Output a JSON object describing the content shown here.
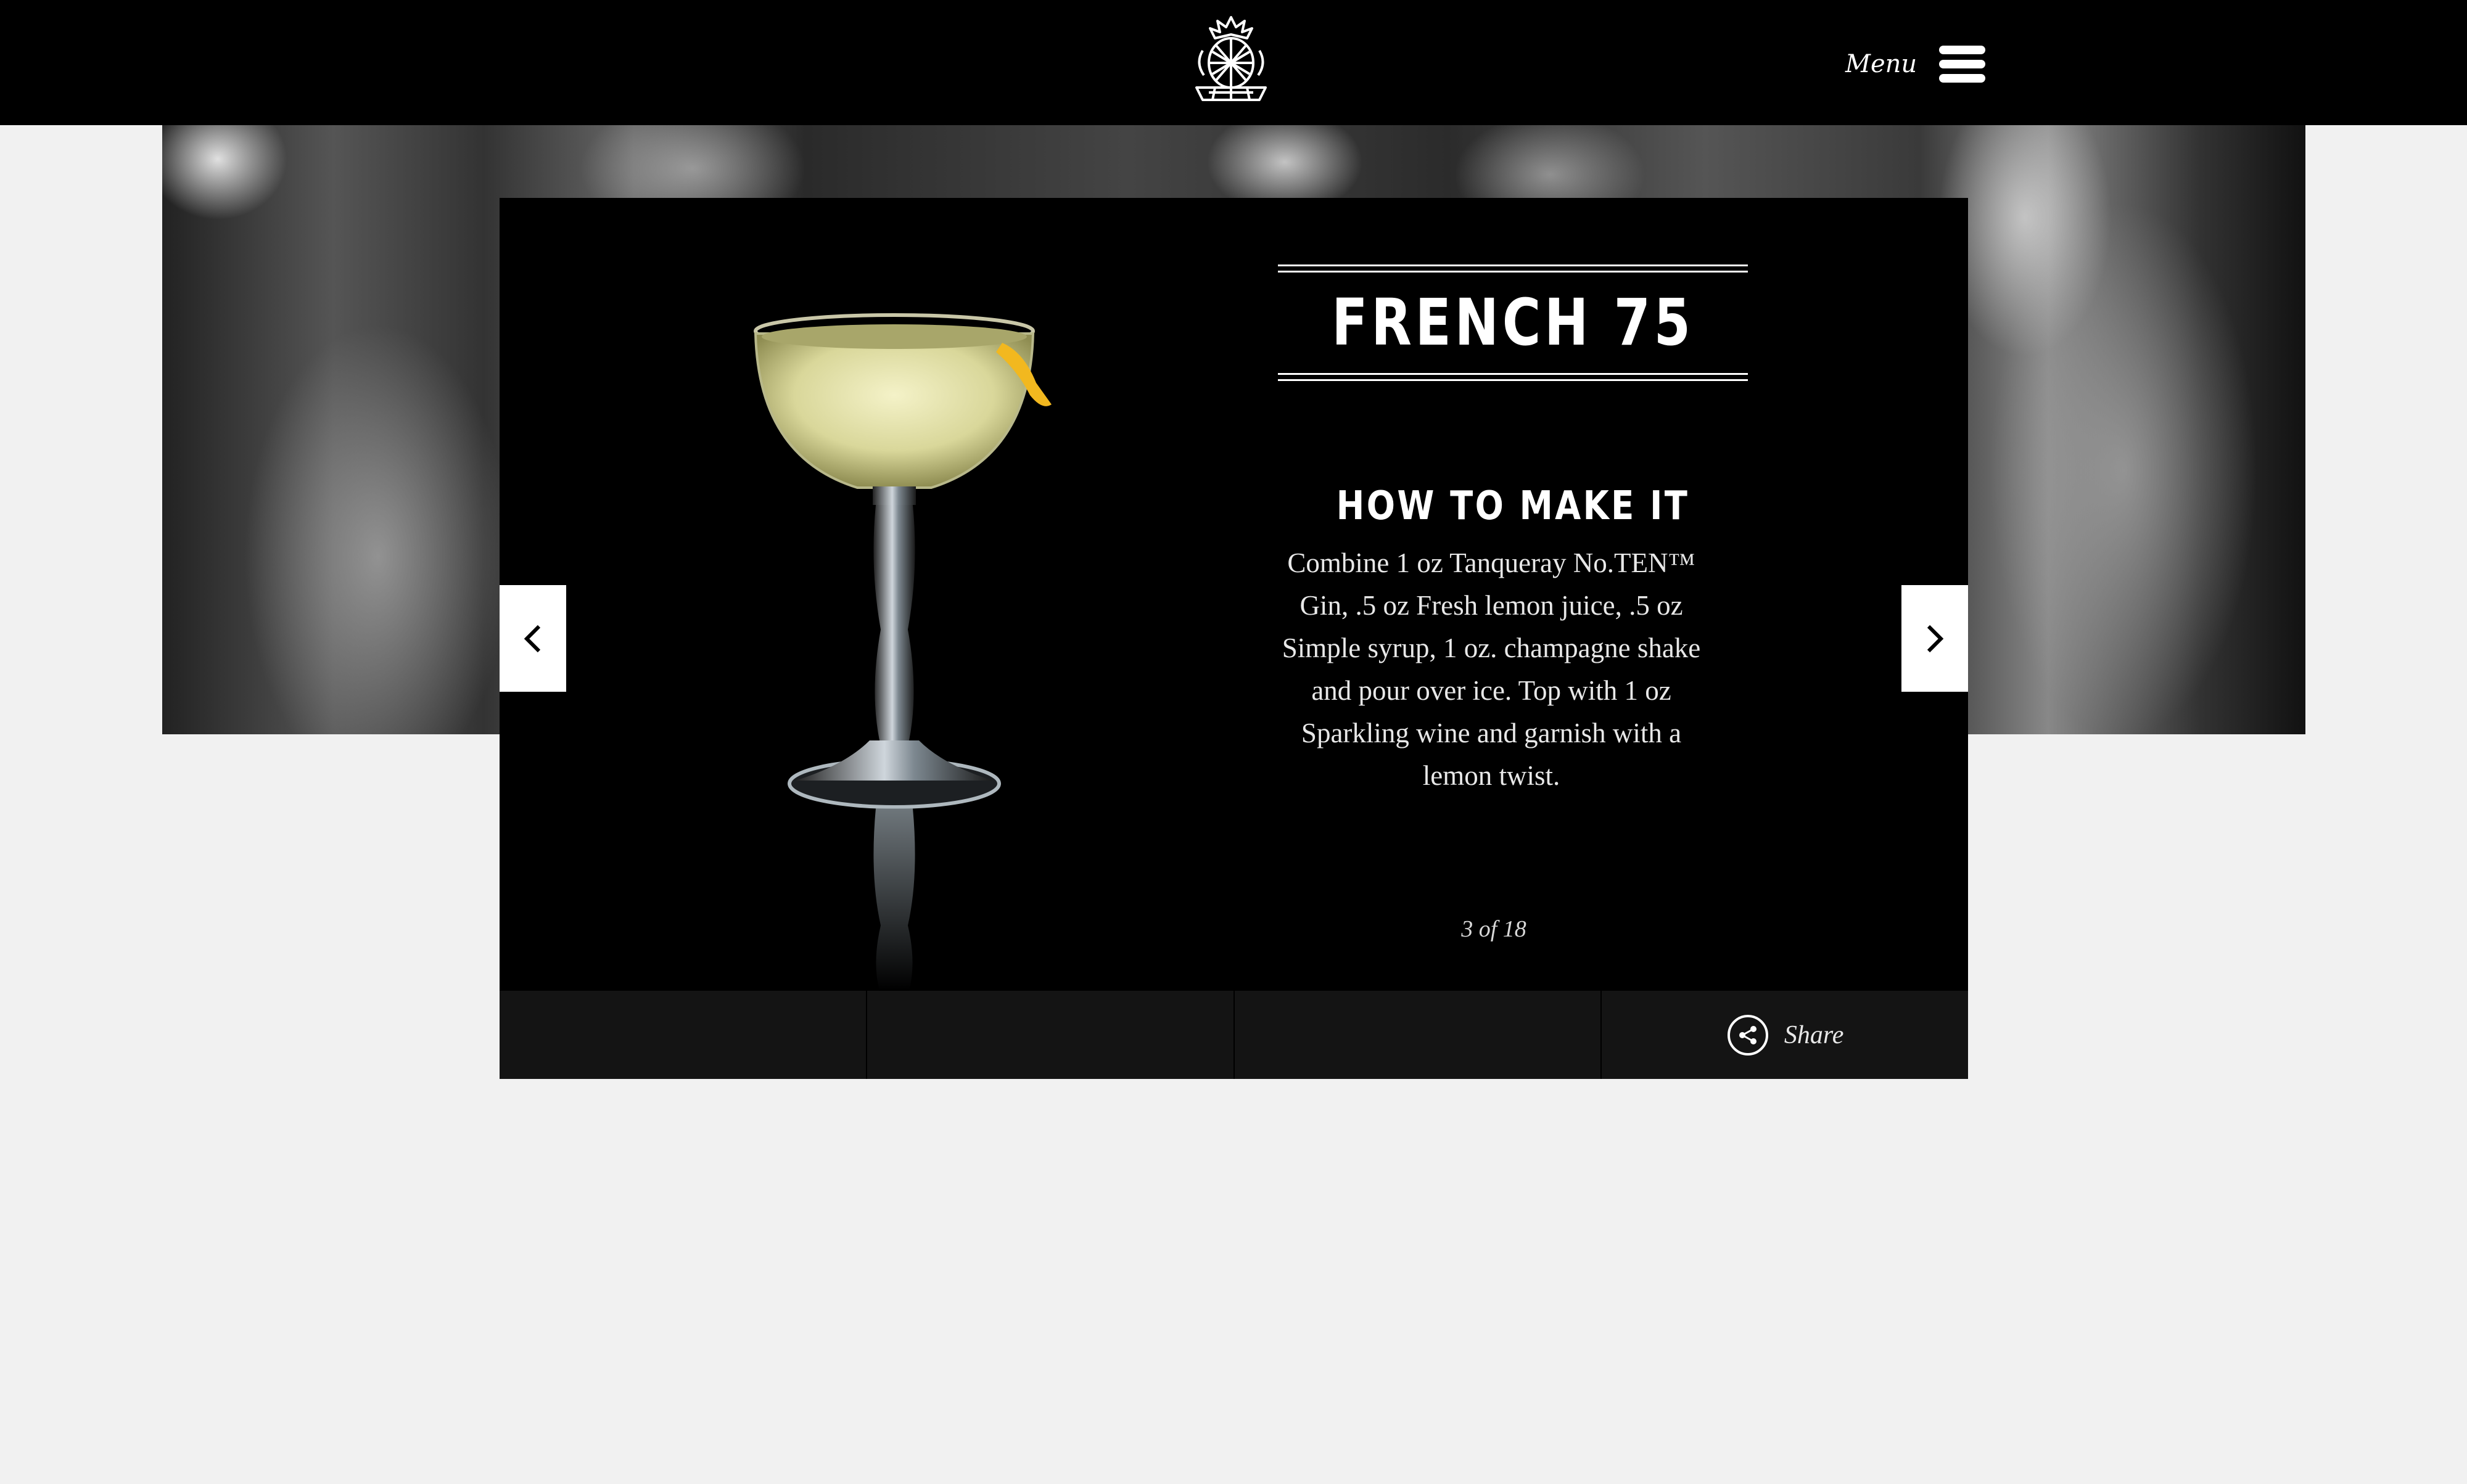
{
  "header": {
    "menu_label": "Menu",
    "logo_icon": "pineapple-crest-logo",
    "menu_icon": "hamburger-icon"
  },
  "colors": {
    "header_bg": "#000000",
    "page_bg": "#f1f1f1",
    "card_bg": "#000000",
    "tabbar_bg": "#141414",
    "text": "#ffffff"
  },
  "drink": {
    "title": "FRENCH 75",
    "section_heading": "HOW TO MAKE IT",
    "recipe_lines": [
      "Combine 1 oz Tanqueray No.TEN™",
      "Gin, .5 oz Fresh lemon juice, .5 oz",
      "Simple syrup, 1 oz. champagne shake",
      "and pour over ice. Top with 1 oz",
      "Sparkling wine and garnish with a",
      "lemon twist."
    ],
    "counter": "3 of 18"
  },
  "nav": {
    "prev_icon": "chevron-left-icon",
    "next_icon": "chevron-right-icon"
  },
  "footer_tabs": {
    "share_label": "Share",
    "share_icon": "share-icon"
  }
}
